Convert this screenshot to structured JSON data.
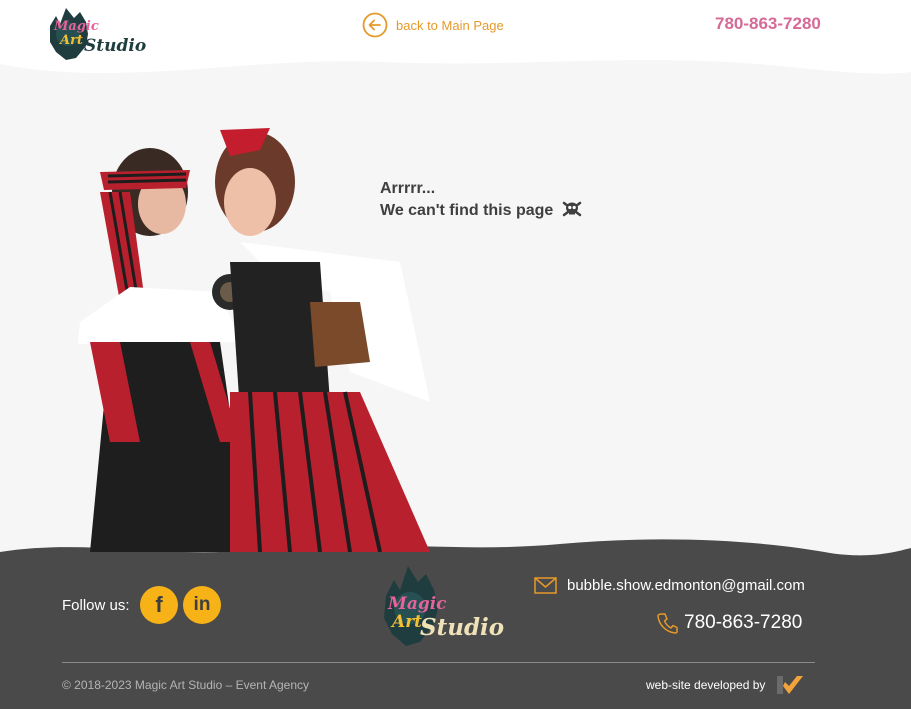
{
  "header": {
    "logo_top": "Magic",
    "logo_mid": "Art",
    "logo_script": "Studio",
    "back_label": "back to Main Page",
    "phone": "780-863-7280"
  },
  "main": {
    "line1": "Arrrrr...",
    "line2": "We can't find this page",
    "icon": "skull-crossbones-icon",
    "image": "pirate-costume-women-photo"
  },
  "footer": {
    "follow_label": "Follow us:",
    "social": [
      {
        "name": "facebook",
        "glyph": "f"
      },
      {
        "name": "linkedin",
        "glyph": "in"
      }
    ],
    "email": "bubble.show.edmonton@gmail.com",
    "phone": "780-863-7280",
    "copyright": "© 2018-2023 Magic Art Studio – Event Agency",
    "developed_by": "web-site developed by"
  },
  "colors": {
    "accent_orange": "#e59a2a",
    "pink": "#d66a96",
    "footer_bg": "#4a4a4a",
    "content_bg": "#f6f6f6",
    "social_yellow": "#f7b217",
    "logo_teal": "#1f3d3f"
  }
}
